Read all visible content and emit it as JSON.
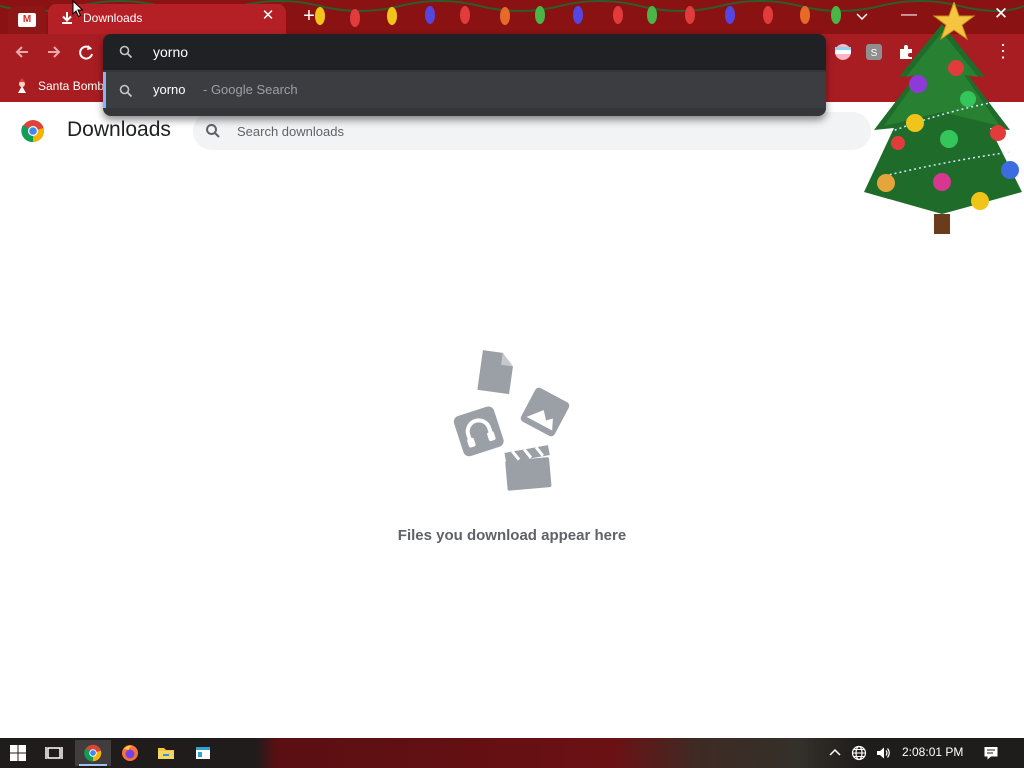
{
  "browser": {
    "tabs": [
      {
        "label": "",
        "icon": "gmail-icon"
      },
      {
        "label": "Downloads",
        "icon": "download-icon",
        "active": true
      }
    ],
    "new_tab_label": "+",
    "close_tab_glyph": "✕",
    "window_min_glyph": "—",
    "window_close_glyph": "✕",
    "menu_glyph": "⋮"
  },
  "omnibox": {
    "input_value": "yorno",
    "suggestion": {
      "query": "yorno",
      "description": "- Google Search"
    }
  },
  "bookmarks": [
    {
      "label": "Santa Bomb"
    }
  ],
  "page": {
    "title": "Downloads",
    "search_placeholder": "Search downloads",
    "empty_message": "Files you download appear here"
  },
  "taskbar": {
    "apps": [
      "windows-start",
      "task-view",
      "chrome",
      "firefox",
      "file-explorer",
      "app"
    ],
    "clock": "2:08:01 PM"
  },
  "colors": {
    "theme_red": "#a81d22",
    "tab_strip": "#8a1212",
    "omnibox_bg": "#35363a",
    "omnibox_accent": "#8ab4f8",
    "empty_icon": "#9aa0a6"
  }
}
